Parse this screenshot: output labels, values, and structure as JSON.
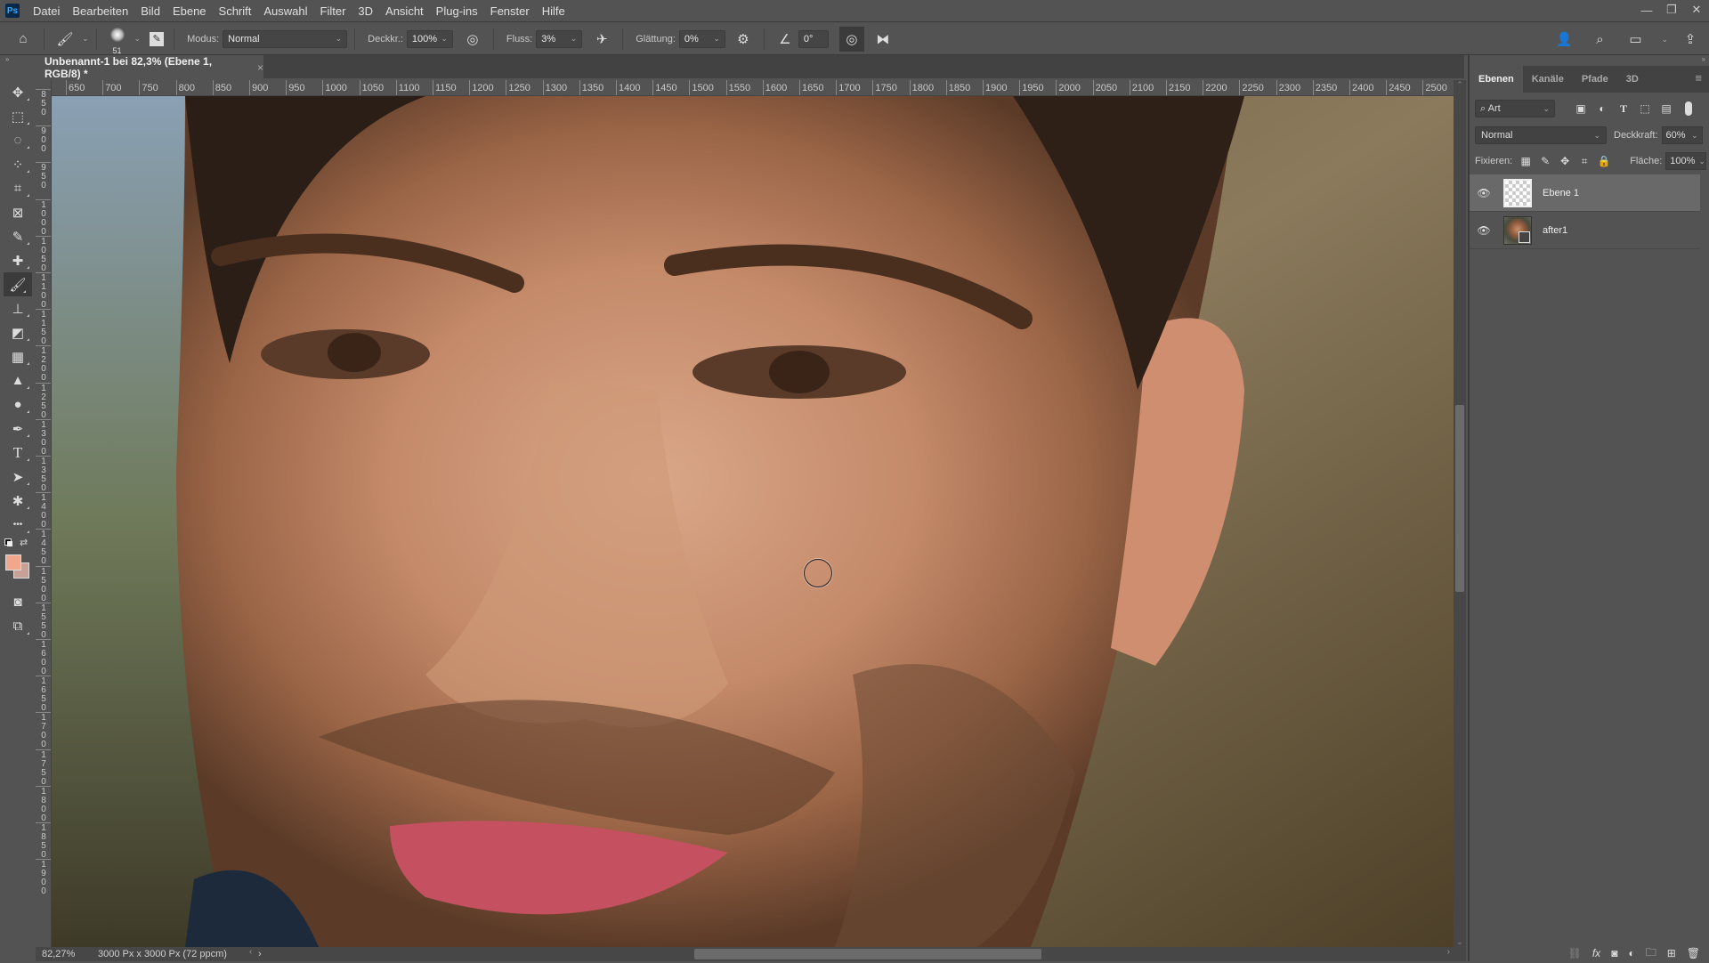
{
  "app": {
    "logo": "Ps"
  },
  "menu": [
    "Datei",
    "Bearbeiten",
    "Bild",
    "Ebene",
    "Schrift",
    "Auswahl",
    "Filter",
    "3D",
    "Ansicht",
    "Plug-ins",
    "Fenster",
    "Hilfe"
  ],
  "window_controls": {
    "minimize": "—",
    "restore": "❐",
    "close": "✕"
  },
  "options_bar": {
    "brush_size": "51",
    "mode_label": "Modus:",
    "mode_value": "Normal",
    "opacity_label": "Deckkr.:",
    "opacity_value": "100%",
    "flow_label": "Fluss:",
    "flow_value": "3%",
    "smoothing_label": "Glättung:",
    "smoothing_value": "0%",
    "angle_value": "0°"
  },
  "document": {
    "tab_title": "Unbenannt-1 bei 82,3% (Ebene 1, RGB/8) *",
    "close": "×",
    "zoom": "82,27%",
    "info": "3000 Px x 3000 Px (72 ppcm)",
    "status_arrow": "›"
  },
  "ruler_top": [
    "650",
    "700",
    "750",
    "800",
    "850",
    "900",
    "950",
    "1000",
    "1050",
    "1100",
    "1150",
    "1200",
    "1250",
    "1300",
    "1350",
    "1400",
    "1450",
    "1500",
    "1550",
    "1600",
    "1650",
    "1700",
    "1750",
    "1800",
    "1850",
    "1900",
    "1950",
    "2000",
    "2050",
    "2100",
    "2150",
    "2200",
    "2250",
    "2300",
    "2350",
    "2400",
    "2450",
    "2500"
  ],
  "ruler_left": [
    "850",
    "900",
    "950",
    "1000",
    "1050",
    "1100",
    "1150",
    "1200",
    "1250",
    "1300",
    "1350",
    "1400",
    "1450",
    "1500",
    "1550",
    "1600",
    "1650",
    "1700",
    "1750",
    "1800",
    "1850",
    "1900"
  ],
  "tools": [
    {
      "name": "move-tool",
      "glyph": "✥"
    },
    {
      "name": "marquee-tool",
      "glyph": "⬚"
    },
    {
      "name": "lasso-tool",
      "glyph": "◌"
    },
    {
      "name": "quick-selection-tool",
      "glyph": "⁘"
    },
    {
      "name": "crop-tool",
      "glyph": "⌗"
    },
    {
      "name": "frame-tool",
      "glyph": "⊠"
    },
    {
      "name": "eyedropper-tool",
      "glyph": "✎"
    },
    {
      "name": "healing-brush-tool",
      "glyph": "✚"
    },
    {
      "name": "brush-tool",
      "glyph": "🖌"
    },
    {
      "name": "clone-stamp-tool",
      "glyph": "⊥"
    },
    {
      "name": "eraser-tool",
      "glyph": "◩"
    },
    {
      "name": "gradient-tool",
      "glyph": "▦"
    },
    {
      "name": "blur-tool",
      "glyph": "▲"
    },
    {
      "name": "dodge-tool",
      "glyph": "●"
    },
    {
      "name": "pen-tool",
      "glyph": "✒"
    },
    {
      "name": "type-tool",
      "glyph": "T"
    },
    {
      "name": "path-selection-tool",
      "glyph": "➤"
    },
    {
      "name": "shape-tool",
      "glyph": "✱"
    },
    {
      "name": "more-tools",
      "glyph": "•••"
    }
  ],
  "colors": {
    "foreground": "#f0a78c",
    "background": "#c7a197",
    "accent": "#31a8ff"
  },
  "layers_panel": {
    "tabs": [
      "Ebenen",
      "Kanäle",
      "Pfade",
      "3D"
    ],
    "filter_label": "Art",
    "blend_mode": "Normal",
    "opacity_label": "Deckkraft:",
    "opacity_value": "60%",
    "lock_label": "Fixieren:",
    "fill_label": "Fläche:",
    "fill_value": "100%",
    "layers": [
      {
        "name": "Ebene 1",
        "visible": true,
        "selected": true,
        "type": "transparent"
      },
      {
        "name": "after1",
        "visible": true,
        "selected": false,
        "type": "smart-object"
      }
    ]
  }
}
